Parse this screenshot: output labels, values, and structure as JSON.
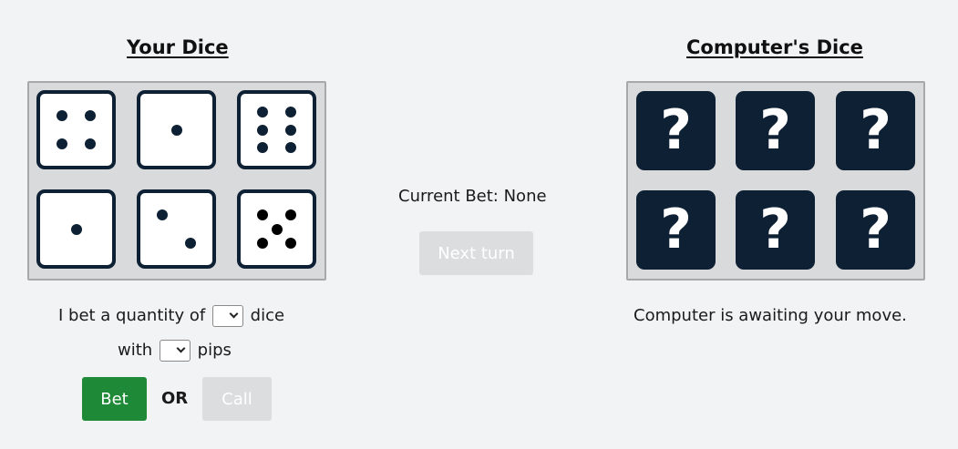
{
  "player": {
    "heading": "Your Dice",
    "dice": [
      4,
      1,
      6,
      1,
      2,
      5
    ]
  },
  "computer": {
    "heading": "Computer's Dice",
    "hidden_symbol": "?",
    "status": "Computer is awaiting your move."
  },
  "center": {
    "current_bet": "Current Bet: None",
    "next_turn_label": "Next turn"
  },
  "bet_form": {
    "prefix": "I bet a quantity of",
    "suffix_dice": "dice",
    "with_label": "with",
    "suffix_pips": "pips",
    "quantity_value": "",
    "pips_value": "",
    "bet_label": "Bet",
    "or_label": "OR",
    "call_label": "Call"
  },
  "colors": {
    "die_border": "#0e2033",
    "hidden_die": "#0e2033",
    "bet_button": "#1e8a38",
    "disabled_button": "#dcdddf",
    "board": "#d9dadc",
    "background": "#f2f3f5"
  }
}
